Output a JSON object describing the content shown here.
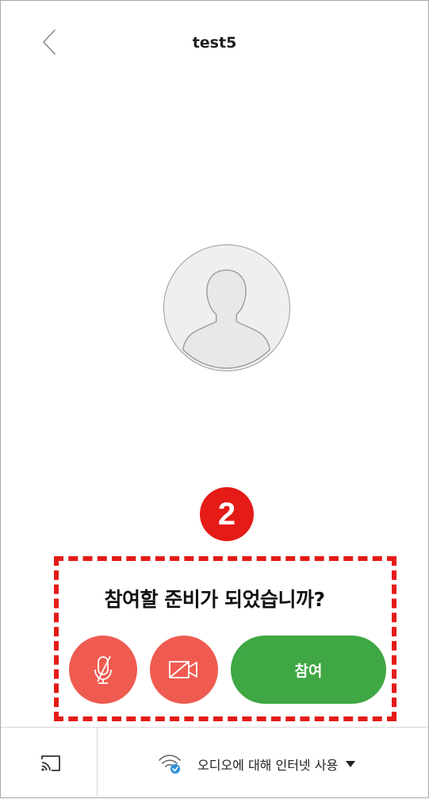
{
  "header": {
    "title": "test5",
    "back_icon": "chevron-left-icon"
  },
  "avatar": {
    "icon": "default-user-avatar-icon"
  },
  "step_badge": {
    "number": "2"
  },
  "join_panel": {
    "prompt": "참여할 준비가 되었습니까?",
    "mic_icon": "microphone-muted-icon",
    "camera_icon": "video-off-icon",
    "join_label": "참여"
  },
  "bottom_bar": {
    "cast_icon": "cast-icon",
    "audio_icon": "wifi-check-icon",
    "audio_label": "오디오에 대해 인터넷 사용",
    "dropdown_icon": "caret-down-icon"
  },
  "colors": {
    "accent_red": "#e41b17",
    "muted_button": "#ef5b50",
    "join_green": "#3fa744"
  }
}
